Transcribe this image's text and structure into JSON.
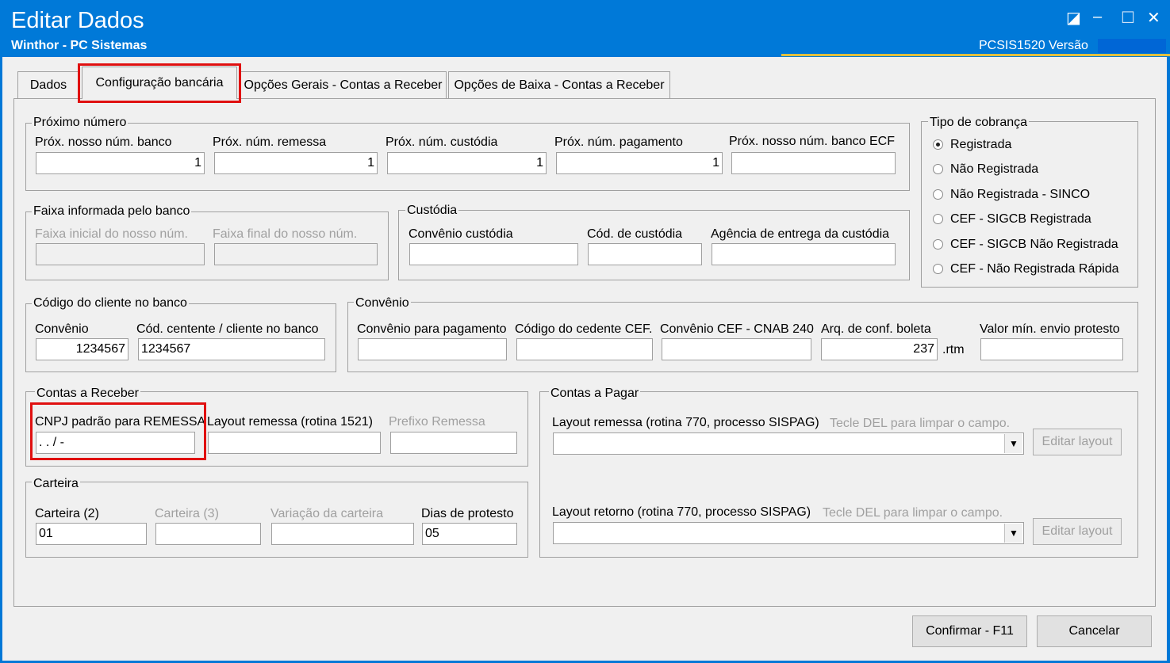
{
  "window": {
    "title": "Editar Dados",
    "subtitle": "Winthor - PC Sistemas",
    "code_version": "PCSIS1520  Versão",
    "controls": {
      "pin": "◪",
      "minimize": "–",
      "maximize": "☐",
      "close": "✕"
    }
  },
  "tabs": [
    {
      "label": "Dados"
    },
    {
      "label": "Configuração bancária"
    },
    {
      "label": "Opções Gerais - Contas a Receber"
    },
    {
      "label": "Opções de Baixa - Contas a Receber"
    }
  ],
  "proximo_numero": {
    "title": "Próximo número",
    "fields": [
      {
        "label": "Próx. nosso núm. banco",
        "value": "1"
      },
      {
        "label": "Próx. núm. remessa",
        "value": "1"
      },
      {
        "label": "Próx. núm. custódia",
        "value": "1"
      },
      {
        "label": "Próx. núm. pagamento",
        "value": "1"
      },
      {
        "label": "Próx. nosso núm. banco ECF",
        "value": ""
      }
    ]
  },
  "tipo_cobranca": {
    "title": "Tipo de cobrança",
    "options": [
      {
        "label": "Registrada",
        "selected": true
      },
      {
        "label": "Não Registrada",
        "selected": false
      },
      {
        "label": "Não Registrada - SINCO",
        "selected": false
      },
      {
        "label": "CEF - SIGCB Registrada",
        "selected": false
      },
      {
        "label": "CEF - SIGCB Não Registrada",
        "selected": false
      },
      {
        "label": "CEF - Não Registrada Rápida",
        "selected": false
      }
    ]
  },
  "faixa": {
    "title": "Faixa informada pelo banco",
    "inicial_label": "Faixa inicial do nosso núm.",
    "final_label": "Faixa final do nosso núm."
  },
  "custodia": {
    "title": "Custódia",
    "convenio_label": "Convênio custódia",
    "cod_label": "Cód. de custódia",
    "agencia_label": "Agência de entrega da custódia"
  },
  "codigo_cliente": {
    "title": "Código do cliente no banco",
    "convenio_label": "Convênio",
    "convenio_value": "1234567",
    "cedente_label": "Cód. centente / cliente no banco",
    "cedente_value": "1234567"
  },
  "convenio": {
    "title": "Convênio",
    "pagamento_label": "Convênio para pagamento",
    "cedente_cef_label": "Código do cedente CEF.",
    "cnab_label": "Convênio CEF - CNAB 240",
    "arq_label": "Arq. de conf. boleta",
    "arq_value": "237",
    "arq_ext": ".rtm",
    "valor_min_label": "Valor mín. envio protesto"
  },
  "contas_receber": {
    "title": "Contas a Receber",
    "cnpj_label": "CNPJ padrão para REMESSA",
    "cnpj_value": " .  .  /   -",
    "layout_label": "Layout remessa (rotina 1521)",
    "prefixo_label": "Prefixo Remessa"
  },
  "carteira": {
    "title": "Carteira",
    "carteira2_label": "Carteira (2)",
    "carteira2_value": "01",
    "carteira3_label": "Carteira (3)",
    "variacao_label": "Variação da carteira",
    "dias_label": "Dias de protesto",
    "dias_value": "05"
  },
  "contas_pagar": {
    "title": "Contas a Pagar",
    "remessa_label": "Layout remessa (rotina 770, processo SISPAG)",
    "retorno_label": "Layout retorno (rotina 770, processo SISPAG)",
    "hint": "Tecle DEL para limpar o campo.",
    "editar_label": "Editar layout"
  },
  "footer": {
    "confirm_label": "Confirmar - F11",
    "cancel_label": "Cancelar"
  }
}
